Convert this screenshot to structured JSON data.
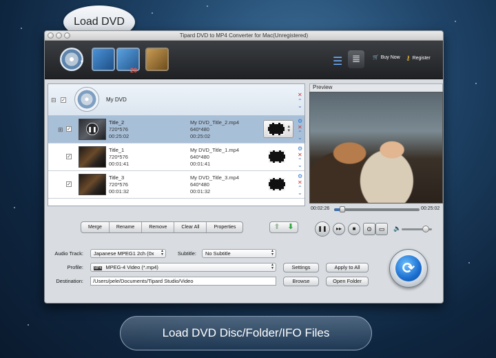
{
  "callout": {
    "text": "Load DVD"
  },
  "window": {
    "title": "Tipard DVD to MP4 Converter for Mac(Unregistered)"
  },
  "toolbar": {
    "buy_now": "Buy Now",
    "register": "Register",
    "sub_badge": "20"
  },
  "list": {
    "dvd": {
      "name": "My DVD"
    },
    "titles": [
      {
        "name": "Title_2",
        "resolution": "720*576",
        "duration": "00:25:02",
        "output_name": "My DVD_Title_2.mp4",
        "output_res": "640*480",
        "output_duration": "00:25:02"
      },
      {
        "name": "Title_1",
        "resolution": "720*576",
        "duration": "00:01:41",
        "output_name": "My DVD_Title_1.mp4",
        "output_res": "640*480",
        "output_duration": "00:01:41"
      },
      {
        "name": "Title_3",
        "resolution": "720*576",
        "duration": "00:01:32",
        "output_name": "My DVD_Title_3.mp4",
        "output_res": "640*480",
        "output_duration": "00:01:32"
      }
    ]
  },
  "preview": {
    "label": "Preview",
    "current_time": "00:02:26",
    "total_time": "00:25:02",
    "progress": 0.1
  },
  "actions": {
    "merge": "Merge",
    "rename": "Rename",
    "remove": "Remove",
    "clear_all": "Clear All",
    "properties": "Properties"
  },
  "settings": {
    "audio_track_label": "Audio Track:",
    "audio_track_value": "Japanese MPEG1 2ch (0x",
    "subtitle_label": "Subtitle:",
    "subtitle_value": "No Subtitle",
    "profile_label": "Profile:",
    "profile_value": "MPEG-4 Video (*.mp4)",
    "profile_badge": "MP4",
    "destination_label": "Destination:",
    "destination_value": "/Users/pele/Documents/Tipard Studio/Video",
    "settings_btn": "Settings",
    "apply_all_btn": "Apply to All",
    "browse_btn": "Browse",
    "open_folder_btn": "Open Folder"
  },
  "volume": 0.8,
  "caption": "Load DVD Disc/Folder/IFO Files",
  "colors": {
    "accent": "#2d7bd6",
    "selected_row": "#a8bfd8",
    "remove_x": "#d13030"
  }
}
